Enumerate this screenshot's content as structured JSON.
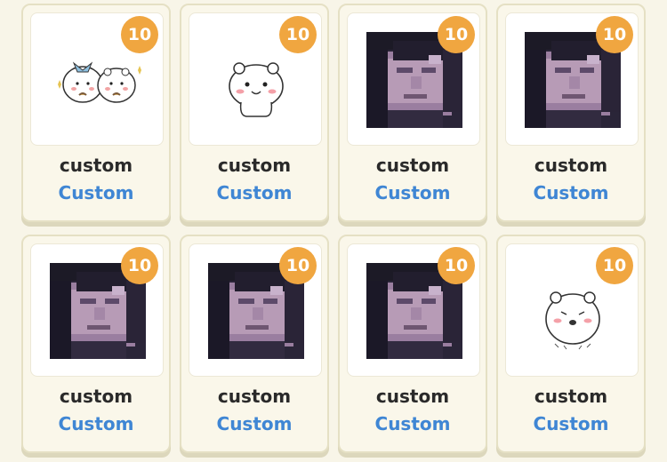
{
  "items": [
    {
      "badge": "10",
      "name": "custom",
      "category": "Custom",
      "image": "two-white-bear-characters-sticker"
    },
    {
      "badge": "10",
      "name": "custom",
      "category": "Custom",
      "image": "white-bear-character-sticker"
    },
    {
      "badge": "10",
      "name": "custom",
      "category": "Custom",
      "image": "pixelated-face-photo"
    },
    {
      "badge": "10",
      "name": "custom",
      "category": "Custom",
      "image": "pixelated-face-photo"
    },
    {
      "badge": "10",
      "name": "custom",
      "category": "Custom",
      "image": "pixelated-face-photo"
    },
    {
      "badge": "10",
      "name": "custom",
      "category": "Custom",
      "image": "pixelated-face-photo"
    },
    {
      "badge": "10",
      "name": "custom",
      "category": "Custom",
      "image": "pixelated-face-photo"
    },
    {
      "badge": "10",
      "name": "custom",
      "category": "Custom",
      "image": "white-hamster-character-sticker"
    }
  ],
  "colors": {
    "background": "#f8f5e8",
    "badge": "#f0a640",
    "name_text": "#2a2a2a",
    "category_text": "#3f86d4"
  }
}
